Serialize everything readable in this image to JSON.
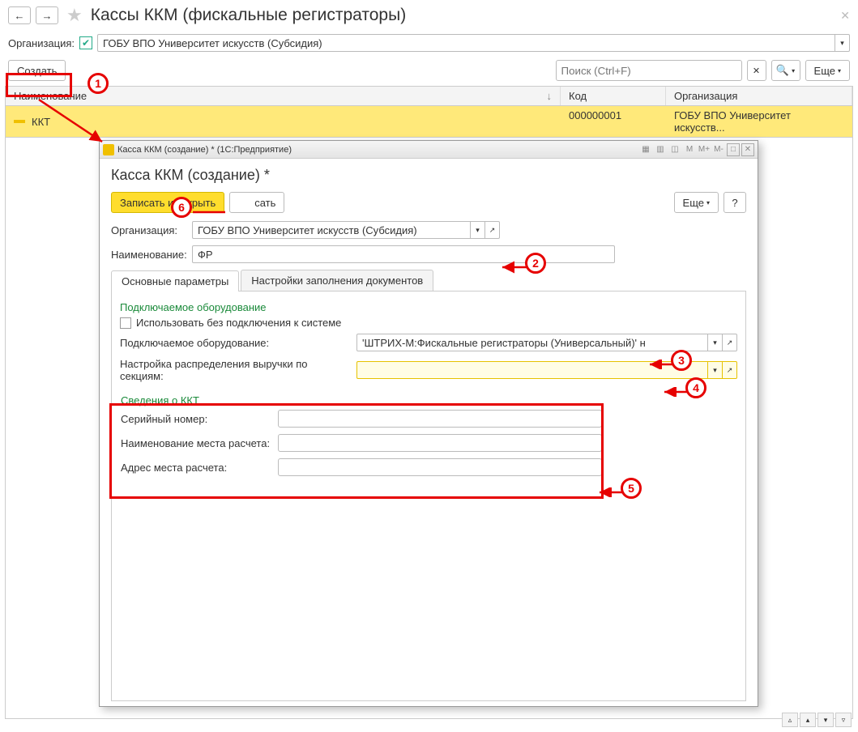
{
  "header": {
    "title": "Кассы ККМ (фискальные регистраторы)"
  },
  "filter": {
    "org_label": "Организация:",
    "org_value": "ГОБУ ВПО Университет искусств (Субсидия)"
  },
  "toolbar": {
    "create": "Создать",
    "search_placeholder": "Поиск (Ctrl+F)",
    "more": "Еще"
  },
  "table": {
    "col_name": "Наименование",
    "col_code": "Код",
    "col_org": "Организация",
    "row": {
      "name": "ККТ",
      "code": "000000001",
      "org": "ГОБУ ВПО Университет искусств..."
    }
  },
  "dialog": {
    "window_title": "Касса ККМ (создание) *  (1С:Предприятие)",
    "tb_tools": [
      "M",
      "M+",
      "M-"
    ],
    "title": "Касса ККМ (создание) *",
    "save_close": "Записать и закрыть",
    "save_partial": "сать",
    "more": "Еще",
    "help": "?",
    "org_label": "Организация:",
    "org_value": "ГОБУ ВПО Университет искусств (Субсидия)",
    "name_label": "Наименование:",
    "name_value": "ФР",
    "tabs": {
      "main": "Основные параметры",
      "settings": "Настройки заполнения документов"
    },
    "section_equip": "Подключаемое оборудование",
    "chk_offline": "Использовать без подключения к системе",
    "equip_label": "Подключаемое оборудование:",
    "equip_value": "'ШТРИХ-М:Фискальные регистраторы (Универсальный)' н",
    "sections_label": "Настройка распределения выручки по секциям:",
    "section_kkt": "Сведения о ККТ",
    "serial_label": "Серийный номер:",
    "place_name_label": "Наименование места расчета:",
    "place_addr_label": "Адрес места расчета:"
  },
  "callouts": {
    "c1": "1",
    "c2": "2",
    "c3": "3",
    "c4": "4",
    "c5": "5",
    "c6": "6"
  }
}
